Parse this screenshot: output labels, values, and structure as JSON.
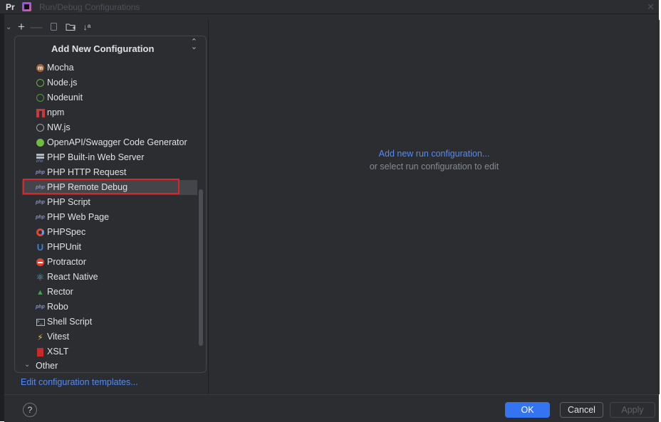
{
  "window": {
    "app_prefix": "Pr",
    "title": "Run/Debug Configurations",
    "close_glyph": "✕"
  },
  "toolbar": {
    "add_glyph": "+",
    "remove_glyph": "—",
    "sort_glyph": "↓ᵃ"
  },
  "popup": {
    "title": "Add New Configuration",
    "collapse_glyph": "⌃⌄",
    "items": [
      {
        "label": "Mocha",
        "icon": "mocha-icon"
      },
      {
        "label": "Node.js",
        "icon": "nodejs-icon"
      },
      {
        "label": "Nodeunit",
        "icon": "nodeunit-icon"
      },
      {
        "label": "npm",
        "icon": "npm-icon"
      },
      {
        "label": "NW.js",
        "icon": "nwjs-icon"
      },
      {
        "label": "OpenAPI/Swagger Code Generator",
        "icon": "openapi-icon"
      },
      {
        "label": "PHP Built-in Web Server",
        "icon": "php-server-icon"
      },
      {
        "label": "PHP HTTP Request",
        "icon": "php-http-icon"
      },
      {
        "label": "PHP Remote Debug",
        "icon": "php-remote-debug-icon",
        "selected": true
      },
      {
        "label": "PHP Script",
        "icon": "php-script-icon"
      },
      {
        "label": "PHP Web Page",
        "icon": "php-web-page-icon"
      },
      {
        "label": "PHPSpec",
        "icon": "phpspec-icon"
      },
      {
        "label": "PHPUnit",
        "icon": "phpunit-icon"
      },
      {
        "label": "Protractor",
        "icon": "protractor-icon"
      },
      {
        "label": "React Native",
        "icon": "react-icon"
      },
      {
        "label": "Rector",
        "icon": "rector-icon"
      },
      {
        "label": "Robo",
        "icon": "robo-icon"
      },
      {
        "label": "Shell Script",
        "icon": "shell-icon"
      },
      {
        "label": "Vitest",
        "icon": "vitest-icon"
      },
      {
        "label": "XSLT",
        "icon": "xslt-icon"
      }
    ],
    "other_label": "Other"
  },
  "left": {
    "edit_templates": "Edit configuration templates..."
  },
  "right": {
    "hint_main": "Add new run configuration...",
    "hint_sub": "or select run configuration to edit"
  },
  "footer": {
    "help": "?",
    "ok": "OK",
    "cancel": "Cancel",
    "apply": "Apply"
  },
  "colors": {
    "background": "#2b2d30",
    "accent": "#3574f0",
    "link": "#548af7",
    "highlight_border": "#d9252b"
  }
}
